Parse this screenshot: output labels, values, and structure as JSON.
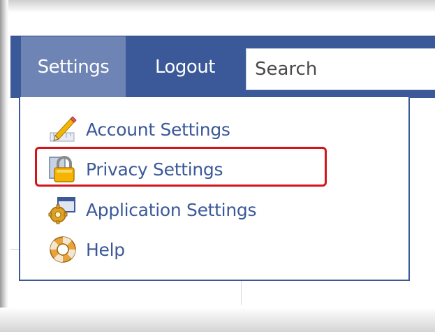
{
  "navbar": {
    "settings_label": "Settings",
    "logout_label": "Logout",
    "search_placeholder": "Search",
    "background_color": "#3b5998",
    "active_tab_color": "#6d84b4"
  },
  "dropdown": {
    "items": [
      {
        "label": "Account Settings",
        "icon": "pencil-ruler-icon"
      },
      {
        "label": "Privacy Settings",
        "icon": "padlock-icon",
        "highlighted": true
      },
      {
        "label": "Application Settings",
        "icon": "application-gear-icon"
      },
      {
        "label": "Help",
        "icon": "lifebuoy-icon"
      }
    ],
    "text_color": "#3b5998",
    "highlight_color": "#d3141a"
  }
}
